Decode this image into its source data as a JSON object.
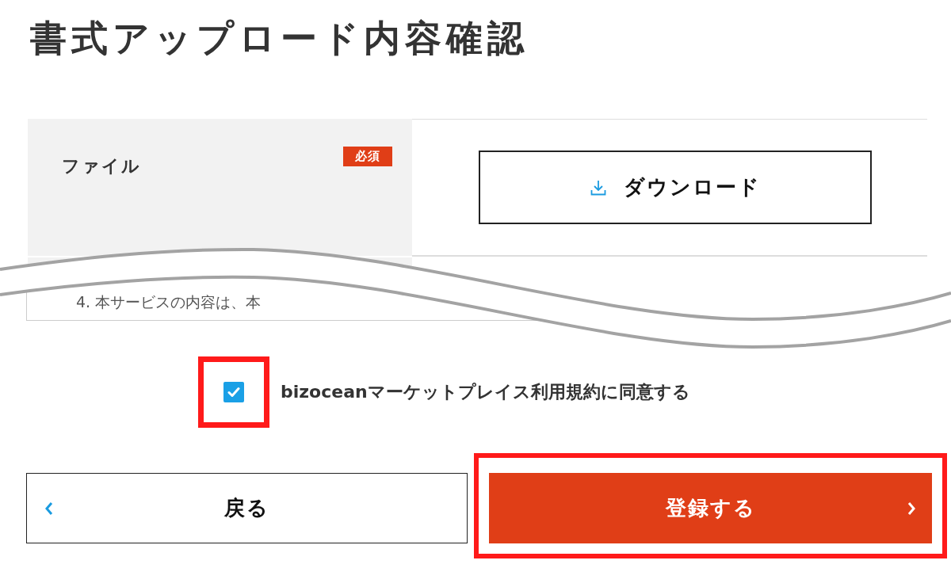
{
  "page_title": "書式アップロード内容確認",
  "form_rows": [
    {
      "label": "ファイル",
      "badge": "必須",
      "action": {
        "kind": "download",
        "label": "ダウンロード"
      }
    }
  ],
  "terms_excerpt": "4. 本サービスの内容は、本",
  "agreement": {
    "label": "bizoceanマーケットプレイス利用規約に同意する",
    "checked": true,
    "highlighted": true
  },
  "buttons": [
    {
      "kind": "back",
      "label": "戻る",
      "highlighted": false
    },
    {
      "kind": "submit",
      "label": "登録する",
      "highlighted": true
    }
  ]
}
